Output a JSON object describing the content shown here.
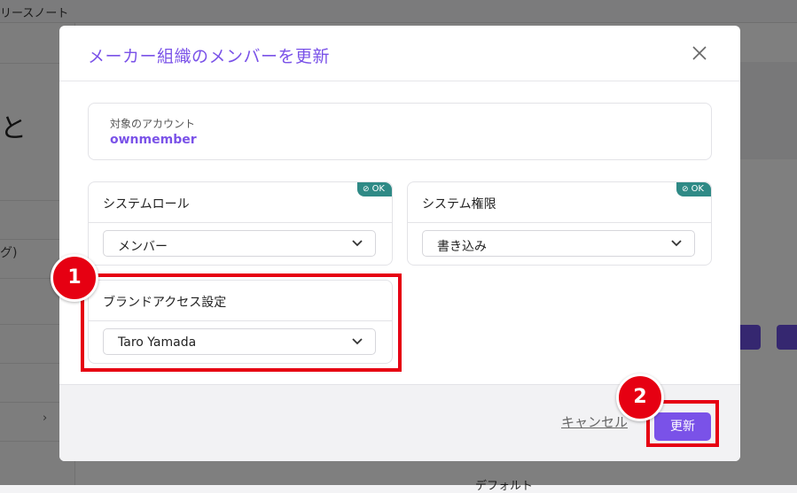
{
  "background": {
    "topbar_title": "リースノート",
    "sidebar_fragment": "グ)",
    "big_char": "と",
    "default_label": "デフォルト"
  },
  "modal": {
    "title": "メーカー組織のメンバーを更新",
    "close_icon": "close-icon",
    "account": {
      "label": "対象のアカウント",
      "value": "ownmember"
    },
    "system_role": {
      "title": "システムロール",
      "badge": "OK",
      "value": "メンバー"
    },
    "system_permission": {
      "title": "システム権限",
      "badge": "OK",
      "value": "書き込み"
    },
    "brand_access": {
      "title": "ブランドアクセス設定",
      "value": "Taro Yamada"
    },
    "cancel_label": "キャンセル",
    "update_label": "更新"
  },
  "annotations": {
    "step1": "1",
    "step2": "2",
    "highlight_color": "#e60012"
  },
  "colors": {
    "accent": "#7a52e8",
    "ok_badge": "#2f8a86"
  }
}
